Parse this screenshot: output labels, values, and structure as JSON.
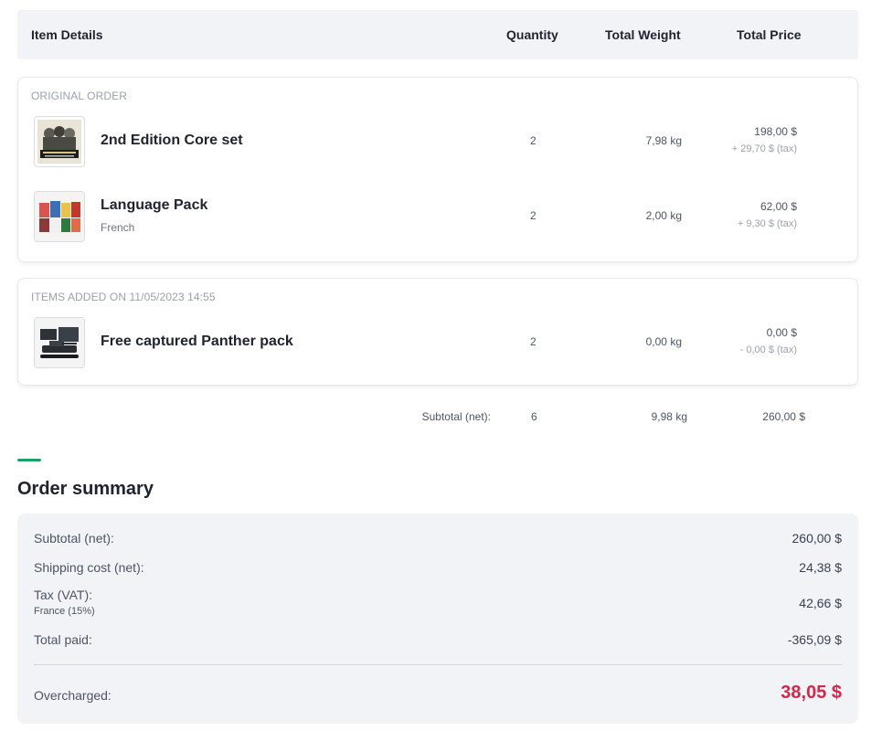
{
  "columns": {
    "item": "Item Details",
    "quantity": "Quantity",
    "weight": "Total Weight",
    "price": "Total Price"
  },
  "original_order": {
    "label": "ORIGINAL ORDER",
    "items": [
      {
        "name": "2nd Edition Core set",
        "variant": "",
        "thumbnail_icon": "core-set-box-icon",
        "quantity": "2",
        "weight": "7,98 kg",
        "price": "198,00 $",
        "tax": "+ 29,70 $ (tax)"
      },
      {
        "name": "Language Pack",
        "variant": "French",
        "thumbnail_icon": "language-pack-box-icon",
        "quantity": "2",
        "weight": "2,00 kg",
        "price": "62,00 $",
        "tax": "+ 9,30 $ (tax)"
      }
    ]
  },
  "added_items": {
    "label": "ITEMS ADDED ON 11/05/2023 14:55",
    "items": [
      {
        "name": "Free captured Panther pack",
        "variant": "",
        "thumbnail_icon": "tank-model-icon",
        "quantity": "2",
        "weight": "0,00 kg",
        "price": "0,00 $",
        "tax": "- 0,00 $ (tax)"
      }
    ]
  },
  "subtotal": {
    "label": "Subtotal (net):",
    "quantity": "6",
    "weight": "9,98 kg",
    "price": "260,00 $"
  },
  "summary": {
    "title": "Order summary",
    "subtotal_label": "Subtotal (net):",
    "subtotal_value": "260,00 $",
    "shipping_label": "Shipping cost (net):",
    "shipping_value": "24,38 $",
    "tax_label": "Tax (VAT):",
    "tax_sub": "France (15%)",
    "tax_value": "42,66 $",
    "total_label": "Total paid:",
    "total_value": "-365,09 $",
    "overcharged_label": "Overcharged:",
    "overcharged_value": "38,05 $"
  },
  "colors": {
    "accent_green": "#1aa360",
    "overcharged_red": "#d6264b",
    "header_bg": "#f2f3f7"
  }
}
